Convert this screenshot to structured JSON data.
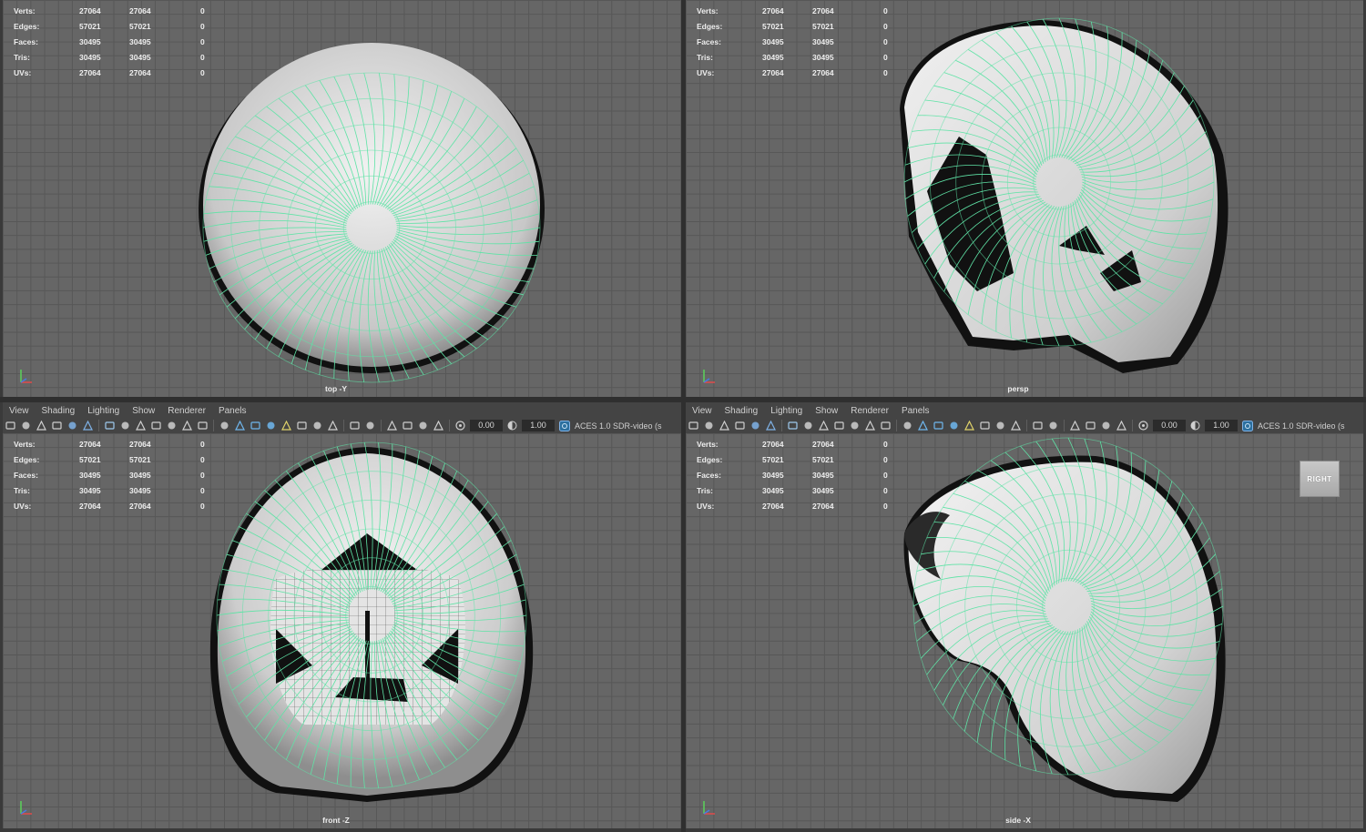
{
  "menu": {
    "left": [
      "View",
      "Shading",
      "Lighting",
      "Show",
      "Renderer",
      "Panels"
    ],
    "right": [
      "View",
      "Shading",
      "Lighting",
      "Show",
      "Renderer",
      "Panels"
    ]
  },
  "toolbar": {
    "exposure_value": "0.00",
    "gamma_value": "1.00",
    "color_management": "ACES 1.0 SDR-video (s",
    "icons": [
      "camera",
      "camera-lock",
      "camera-attr",
      "bookmark",
      "image-plane",
      "grease-pencil",
      "grid-toggle",
      "film-gate",
      "resolution-gate",
      "gate-mask",
      "field-chart",
      "safe-action",
      "safe-title",
      "wireframe",
      "smooth-shade",
      "default-material",
      "textured",
      "lights",
      "shadows",
      "ambient-occlusion",
      "motion-blur",
      "anti-alias",
      "depth-of-field",
      "isolate-select",
      "xray",
      "xray-joints",
      "xray-active",
      "exposure",
      "gamma",
      "color-management"
    ]
  },
  "hud": {
    "labels": [
      "Verts:",
      "Edges:",
      "Faces:",
      "Tris:",
      "UVs:"
    ],
    "col1": [
      "27064",
      "57021",
      "30495",
      "30495",
      "27064"
    ],
    "col2": [
      "27064",
      "57021",
      "30495",
      "30495",
      "27064"
    ],
    "col3": [
      "0",
      "0",
      "0",
      "0",
      "0"
    ]
  },
  "viewports": {
    "top": {
      "camera": "top -Y"
    },
    "persp": {
      "camera": "persp"
    },
    "front": {
      "camera": "front -Z"
    },
    "side": {
      "camera": "side -X",
      "viewcube": "RIGHT"
    }
  },
  "colors": {
    "wire": "#5fe3a6",
    "shade": "#d9d9d9",
    "viewport_bg": "#666666",
    "grid": "#575757"
  }
}
